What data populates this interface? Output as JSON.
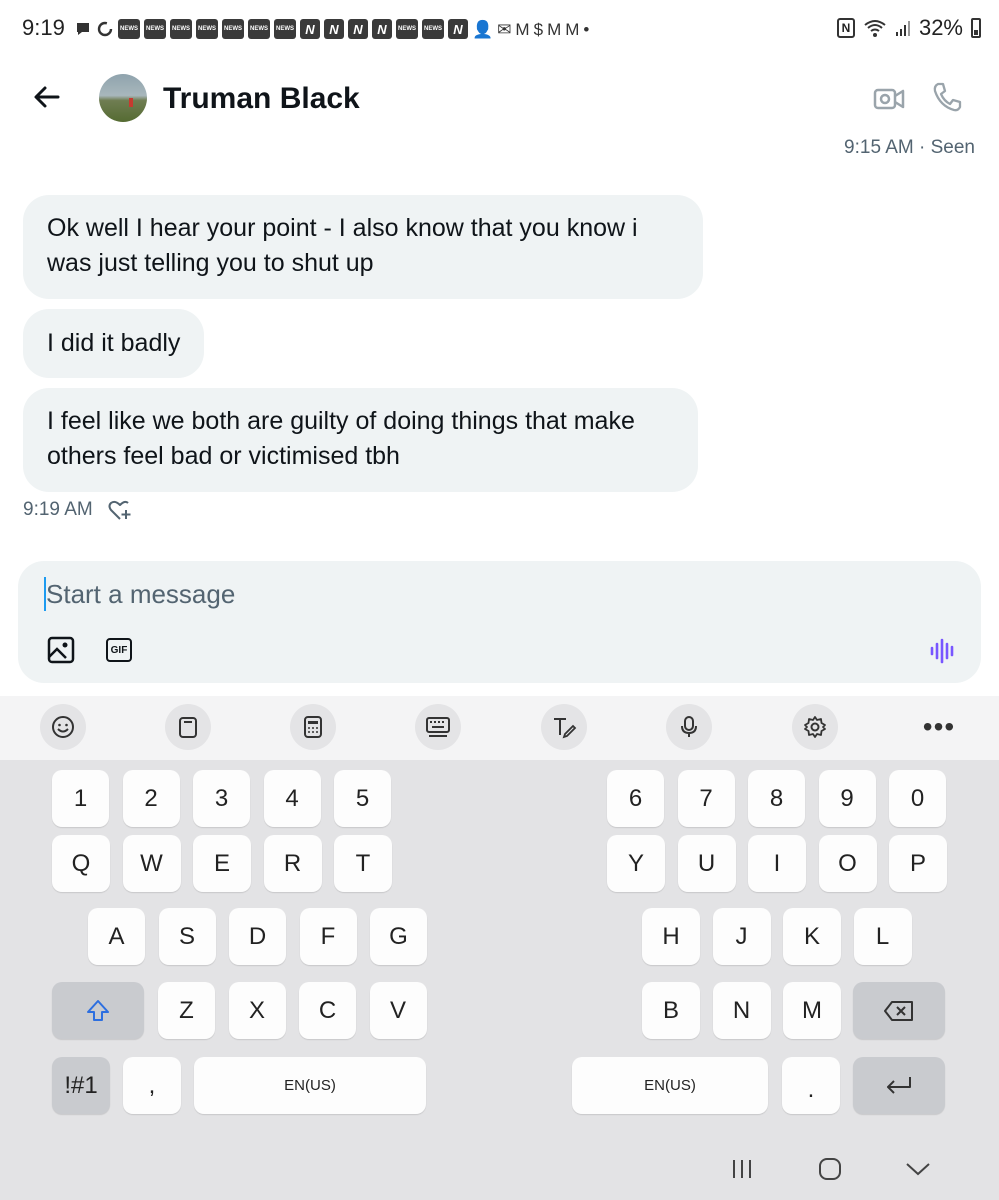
{
  "status_bar": {
    "time": "9:19",
    "battery": "32%",
    "notifications": [
      "chat-bubble",
      "sync",
      "news",
      "news",
      "news",
      "news",
      "news",
      "news",
      "news",
      "n-app",
      "n-app",
      "n-app",
      "n-app",
      "news",
      "news",
      "n-app",
      "person-add",
      "mail",
      "gmail",
      "dollar",
      "gmail",
      "gmail",
      "dot"
    ]
  },
  "header": {
    "contact_name": "Truman Black",
    "seen_status": "9:15 AM · Seen"
  },
  "messages": [
    {
      "text": "Ok well I hear your point - I also know that you know i was just telling you to shut up"
    },
    {
      "text": "I did it badly"
    },
    {
      "text": "I feel like we both are guilty of doing things that make others feel bad or victimised tbh"
    }
  ],
  "last_message_time": "9:19 AM",
  "composer": {
    "placeholder": "Start a message",
    "gif_label": "GIF"
  },
  "keyboard": {
    "toolbar": [
      "emoji",
      "clipboard",
      "keypad",
      "keyboard-mode",
      "handwriting",
      "microphone",
      "settings",
      "more"
    ],
    "more_label": "•••",
    "row1_left": [
      "1",
      "2",
      "3",
      "4",
      "5"
    ],
    "row1_right": [
      "6",
      "7",
      "8",
      "9",
      "0"
    ],
    "row2_left": [
      "Q",
      "W",
      "E",
      "R",
      "T"
    ],
    "row2_right": [
      "Y",
      "U",
      "I",
      "O",
      "P"
    ],
    "row3_left": [
      "A",
      "S",
      "D",
      "F",
      "G"
    ],
    "row3_right": [
      "H",
      "J",
      "K",
      "L"
    ],
    "row4_left": [
      "Z",
      "X",
      "C",
      "V"
    ],
    "row4_right": [
      "B",
      "N",
      "M"
    ],
    "symbols_label": "!#1",
    "comma_label": ",",
    "space_left_label": "EN(US)",
    "space_right_label": "EN(US)",
    "period_label": "."
  },
  "colors": {
    "bubble_bg": "#eff3f4",
    "secondary_text": "#536471",
    "accent": "#1d9bf0",
    "voice_accent": "#7856ff",
    "shift_icon": "#2d6fe0"
  }
}
